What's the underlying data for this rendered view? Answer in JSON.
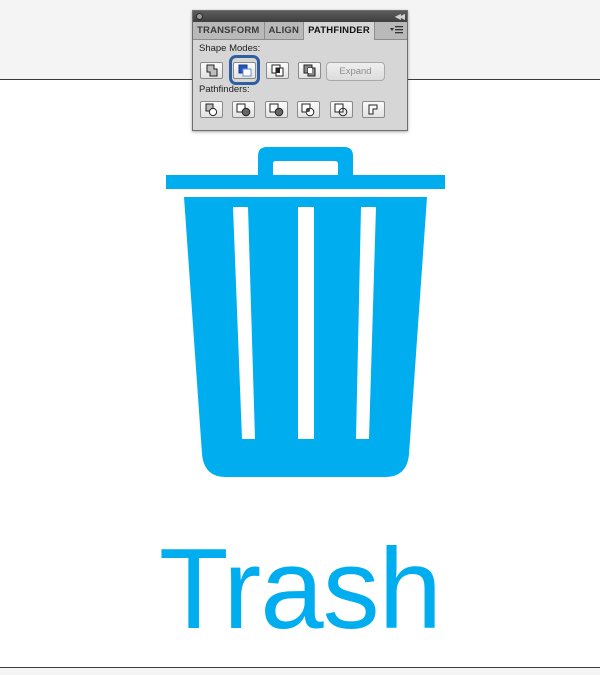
{
  "panel": {
    "tabs": [
      "TRANSFORM",
      "ALIGN",
      "PATHFINDER"
    ],
    "active_tab": "PATHFINDER",
    "shape_modes_label": "Shape Modes:",
    "pathfinders_label": "Pathfinders:",
    "expand_label": "Expand",
    "shape_mode_buttons": [
      "unite-icon",
      "minus-front-icon",
      "intersect-icon",
      "exclude-icon"
    ],
    "selected_shape_mode": "minus-front-icon",
    "pathfinder_buttons": [
      "divide-icon",
      "trim-icon",
      "merge-icon",
      "crop-icon",
      "outline-icon",
      "minus-back-icon"
    ]
  },
  "artwork": {
    "label": "Trash",
    "color": "#00aeef"
  },
  "colors": {
    "highlight": "#2f5f9e",
    "panel_bg": "#d6d6d6"
  }
}
